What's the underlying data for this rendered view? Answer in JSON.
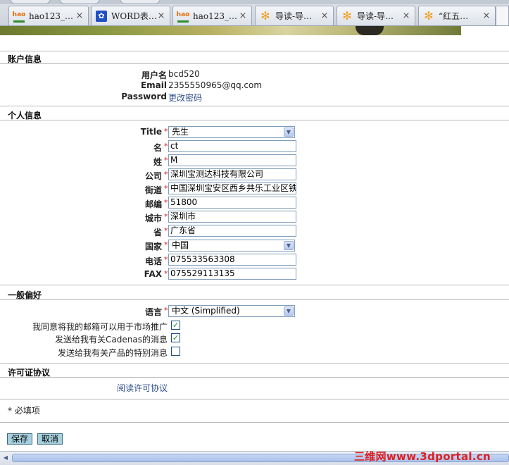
{
  "browser": {
    "tabs": [
      {
        "title": "hao123_…",
        "icon": "hao123-icon"
      },
      {
        "title": "WORD表…",
        "icon": "baidu-paw-icon"
      },
      {
        "title": "hao123_…",
        "icon": "hao123-icon"
      },
      {
        "title": "导读-导…",
        "icon": "flower-icon"
      },
      {
        "title": "导读-导…",
        "icon": "flower-icon"
      },
      {
        "title": "“红五…",
        "icon": "flower-icon"
      }
    ],
    "close_glyph": "×"
  },
  "account": {
    "section_title": "账户信息",
    "username_label": "用户名",
    "username_value": "bcd520",
    "email_label": "Email",
    "email_value": "2355550965@qq.com",
    "password_label": "Password",
    "password_link": "更改密码"
  },
  "personal": {
    "section_title": "个人信息",
    "required_mark": "*",
    "fields": [
      {
        "label": "Title",
        "value": "先生",
        "type": "select"
      },
      {
        "label": "名",
        "value": "ct",
        "type": "text"
      },
      {
        "label": "姓",
        "value": "M",
        "type": "text"
      },
      {
        "label": "公司",
        "value": "深圳宝测达科技有限公司",
        "type": "text"
      },
      {
        "label": "街道",
        "value": "中国深圳宝安区西乡共乐工业区铁",
        "type": "text"
      },
      {
        "label": "邮编",
        "value": "51800",
        "type": "text"
      },
      {
        "label": "城市",
        "value": "深圳市",
        "type": "text"
      },
      {
        "label": "省",
        "value": "广东省",
        "type": "text"
      },
      {
        "label": "国家",
        "value": "中国",
        "type": "select"
      },
      {
        "label": "电话",
        "value": "075533563308",
        "type": "text"
      },
      {
        "label": "FAX",
        "value": "075529113135",
        "type": "text"
      }
    ]
  },
  "preferences": {
    "section_title": "一般偏好",
    "language_label": "语言",
    "language_value": "中文 (Simplified)",
    "checkboxes": [
      {
        "label": "我同意将我的邮箱可以用于市场推广",
        "checked": true
      },
      {
        "label": "发送给我有关Cadenas的消息",
        "checked": true
      },
      {
        "label": "发送给我有关产品的特别消息",
        "checked": false
      }
    ]
  },
  "license": {
    "section_title": "许可证协议",
    "link": "阅读许可协议"
  },
  "footer": {
    "required_note": "* 必填项",
    "save_label": "保存",
    "cancel_label": "取消"
  },
  "watermark": "三维网www.3dportal.cn",
  "colors": {
    "link": "#2f4f8f",
    "required": "#cc2222",
    "button_bg": "#a7d0de",
    "checkmark": "#1f8f1f"
  }
}
